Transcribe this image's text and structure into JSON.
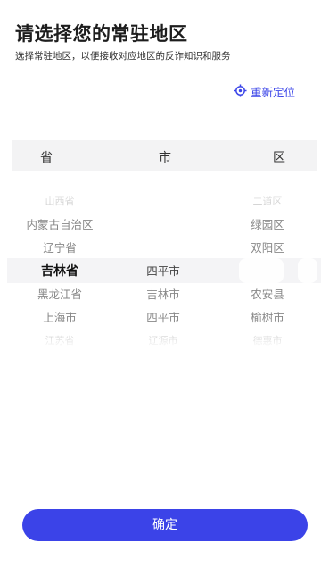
{
  "header": {
    "title": "请选择您的常驻地区",
    "subtitle": "选择常驻地区，以便接收对应地区的反诈知识和服务"
  },
  "relocate": {
    "label": "重新定位",
    "icon": "locate-icon"
  },
  "picker": {
    "columns": [
      "省",
      "市",
      "区"
    ],
    "province": {
      "above": [
        "山西省",
        "内蒙古自治区",
        "辽宁省"
      ],
      "selected": "吉林省",
      "below": [
        "黑龙江省",
        "上海市",
        "江苏省"
      ]
    },
    "city": {
      "above": [],
      "selected": "四平市",
      "below": [
        "吉林市",
        "四平市",
        "辽源市"
      ]
    },
    "district": {
      "above": [
        "二道区",
        "绿园区",
        "双阳区"
      ],
      "selected": "",
      "below": [
        "农安县",
        "榆树市",
        "德惠市"
      ]
    }
  },
  "footer": {
    "confirm_label": "确定"
  },
  "colors": {
    "accent": "#3b43e8",
    "header_bg": "#f3f3f4"
  }
}
